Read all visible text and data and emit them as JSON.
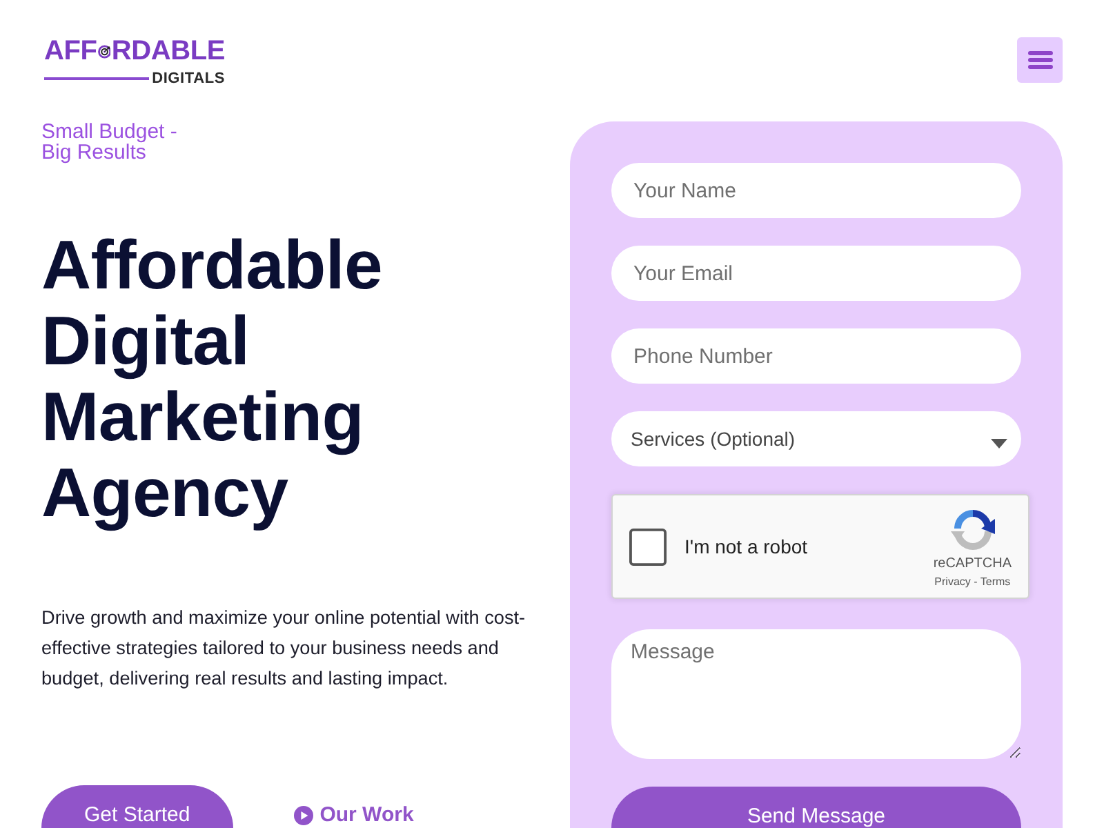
{
  "header": {
    "logo": {
      "word_start": "AFF",
      "word_end": "RDABLE",
      "subtitle": "DIGITALS"
    }
  },
  "hero": {
    "tagline": "Small Budget - Big Results",
    "title": "Affordable Digital Marketing Agency",
    "description": "Drive growth and maximize your online potential with cost-effective strategies tailored to your business needs and budget, delivering real results and lasting impact.",
    "buttons": [
      {
        "kind": "primary",
        "label": "Get Started"
      },
      {
        "kind": "link",
        "label": "Our Work"
      }
    ]
  },
  "contact_form": {
    "fields": [
      {
        "kind": "input",
        "placeholder": "Your Name"
      },
      {
        "kind": "input",
        "placeholder": "Your Email"
      },
      {
        "kind": "input",
        "placeholder": "Phone Number"
      },
      {
        "kind": "select",
        "value": "Services (Optional)"
      },
      {
        "kind": "captcha",
        "label": "I'm not a robot",
        "checked": false,
        "brand": "reCAPTCHA",
        "links": "Privacy - Terms"
      },
      {
        "kind": "textarea",
        "placeholder": "Message"
      }
    ],
    "submit": "Send Message"
  }
}
